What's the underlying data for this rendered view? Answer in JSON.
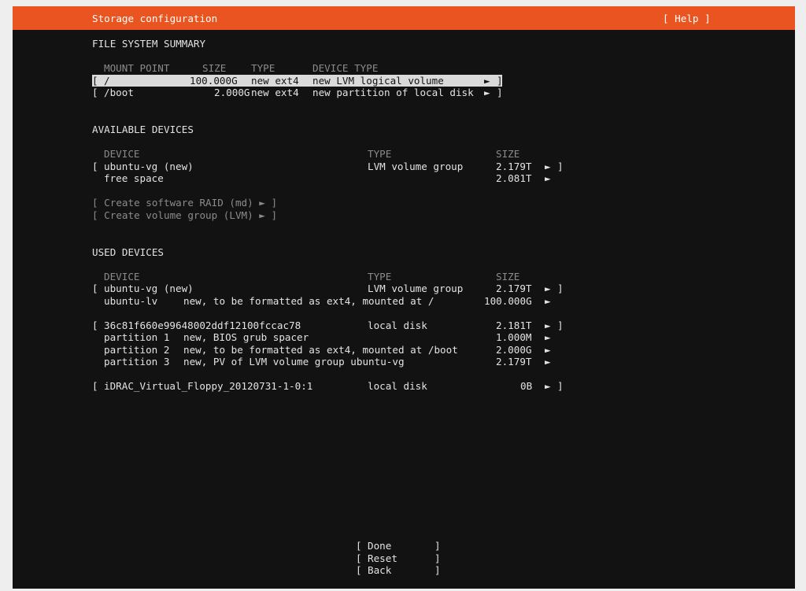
{
  "header": {
    "title": "Storage configuration",
    "help": "[ Help ]"
  },
  "fs_summary": {
    "title": "FILE SYSTEM SUMMARY",
    "columns": {
      "mount": "MOUNT POINT",
      "size": "SIZE",
      "type": "TYPE",
      "device_type": "DEVICE TYPE"
    },
    "rows": [
      {
        "open": "[",
        "mount": "/",
        "size": "100.000G",
        "type": "new ext4",
        "device_type": "new LVM logical volume",
        "arrow": "►",
        "close": "]"
      },
      {
        "open": "[",
        "mount": "/boot",
        "size": "2.000G",
        "type": "new ext4",
        "device_type": "new partition of local disk",
        "arrow": "►",
        "close": "]"
      }
    ]
  },
  "available": {
    "title": "AVAILABLE DEVICES",
    "columns": {
      "device": "DEVICE",
      "type": "TYPE",
      "size": "SIZE"
    },
    "rows": [
      {
        "open": "[",
        "device": "ubuntu-vg (new)",
        "type": "LVM volume group",
        "size": "2.179T",
        "arrow": "►",
        "close": "]"
      },
      {
        "device": "free space",
        "size": "2.081T",
        "arrow": "►"
      }
    ],
    "actions": [
      "[ Create software RAID (md) ► ]",
      "[ Create volume group (LVM) ► ]"
    ]
  },
  "used": {
    "title": "USED DEVICES",
    "columns": {
      "device": "DEVICE",
      "type": "TYPE",
      "size": "SIZE"
    },
    "groups": [
      {
        "open": "[",
        "device": "ubuntu-vg (new)",
        "type": "LVM volume group",
        "size": "2.179T",
        "arrow": "►",
        "close": "]",
        "children": [
          {
            "name": "ubuntu-lv",
            "desc": "new, to be formatted as ext4, mounted at /",
            "size": "100.000G",
            "arrow": "►"
          }
        ]
      },
      {
        "open": "[",
        "device": "36c81f660e99648002ddf12100fccac78",
        "type": "local disk",
        "size": "2.181T",
        "arrow": "►",
        "close": "]",
        "children": [
          {
            "name": "partition 1",
            "desc": "new, BIOS grub spacer",
            "size": "1.000M",
            "arrow": "►"
          },
          {
            "name": "partition 2",
            "desc": "new, to be formatted as ext4, mounted at /boot",
            "size": "2.000G",
            "arrow": "►"
          },
          {
            "name": "partition 3",
            "desc": "new, PV of LVM volume group ubuntu-vg",
            "size": "2.179T",
            "arrow": "►"
          }
        ]
      },
      {
        "open": "[",
        "device": "iDRAC_Virtual_Floppy_20120731-1-0:1",
        "type": "local disk",
        "size": "0B",
        "arrow": "►",
        "close": "]",
        "children": []
      }
    ]
  },
  "buttons": [
    {
      "open": "[",
      "label": "Done",
      "close": "]"
    },
    {
      "open": "[",
      "label": "Reset",
      "close": "]"
    },
    {
      "open": "[",
      "label": "Back",
      "close": "]"
    }
  ]
}
